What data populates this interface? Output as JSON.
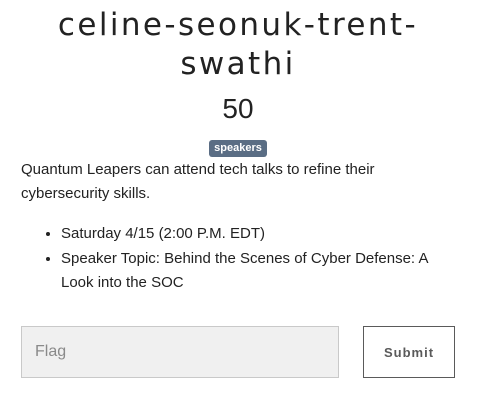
{
  "challenge": {
    "title": "celine-seonuk-trent-swathi",
    "points": "50",
    "tag": "speakers",
    "description": "Quantum Leapers can attend tech talks to refine their cybersecurity skills.",
    "details": [
      "Saturday 4/15 (2:00 P.M. EDT)",
      "Speaker Topic: Behind the Scenes of Cyber Defense: A Look into the SOC"
    ]
  },
  "form": {
    "flag_placeholder": "Flag",
    "flag_value": "",
    "submit_label": "Submit"
  }
}
